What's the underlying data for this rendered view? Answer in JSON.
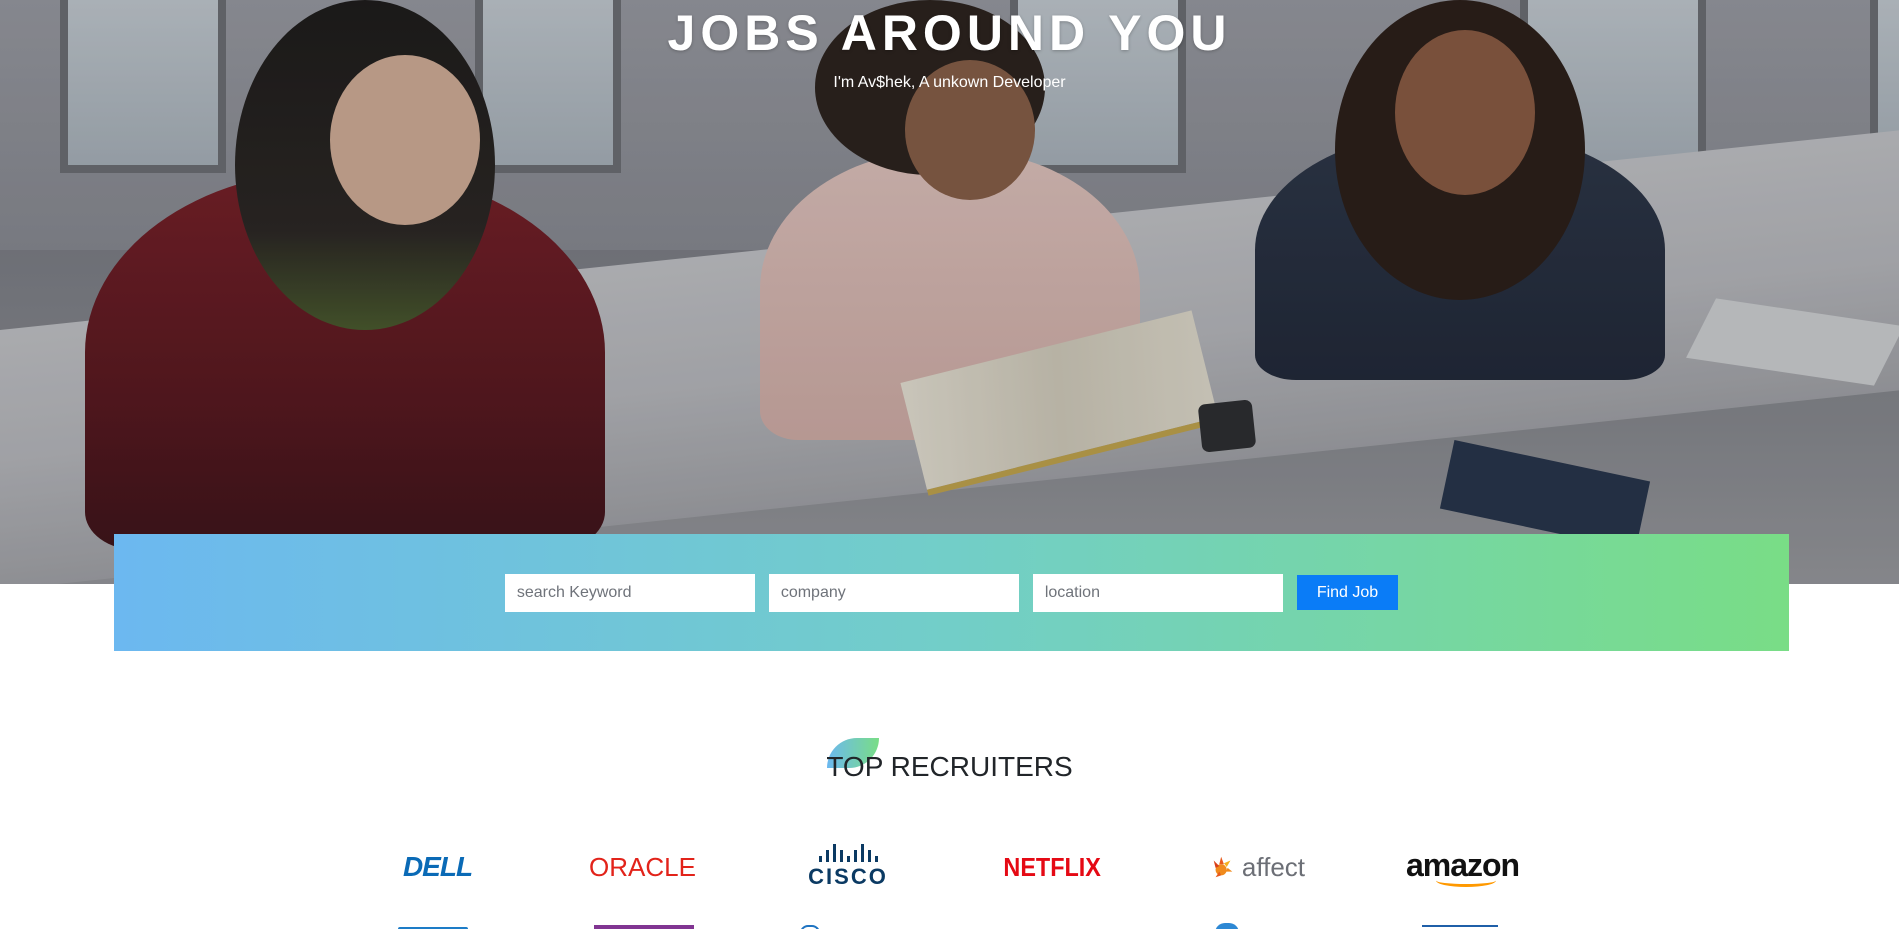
{
  "hero": {
    "title": "JOBS AROUND YOU",
    "subtitle": "I'm Av$hek, A unkown Developer"
  },
  "search": {
    "keyword_placeholder": "search Keyword",
    "company_placeholder": "company",
    "location_placeholder": "location",
    "button_label": "Find Job"
  },
  "recruiters": {
    "title": "TOP RECRUITERS",
    "logos": [
      {
        "name": "dell-logo",
        "text": "DELL"
      },
      {
        "name": "oracle-logo",
        "text": "ORACLE"
      },
      {
        "name": "cisco-logo",
        "text": "CISCO"
      },
      {
        "name": "netflix-logo",
        "text": "NETFLIX"
      },
      {
        "name": "affect-logo",
        "text": "affect"
      },
      {
        "name": "amazon-logo",
        "text": "amazon"
      }
    ]
  },
  "colors": {
    "gradient_start": "#6cb8f0",
    "gradient_end": "#79dd86",
    "button": "#0a7cf7",
    "dell": "#0a6ab6",
    "oracle": "#e2231a",
    "cisco": "#0b3a63",
    "netflix": "#e50914",
    "amazon_smile": "#ff9900"
  }
}
